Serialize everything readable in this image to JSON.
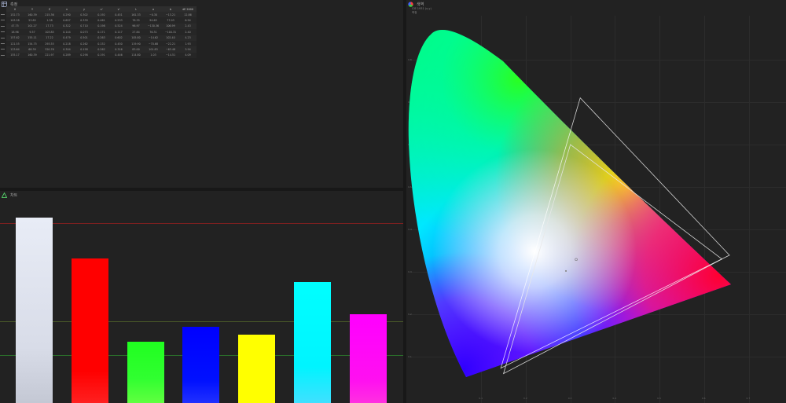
{
  "table_panel": {
    "title": "측정",
    "columns": [
      "X",
      "Y",
      "Z",
      "x",
      "y",
      "u'",
      "v'",
      "L",
      "a",
      "b",
      "dE 2000"
    ],
    "rows": [
      [
        "152.73",
        "160.39",
        "215.36",
        "0.290",
        "0.302",
        "0.192",
        "0.451",
        "161.33",
        "−0.30",
        "−13.21",
        "12.86"
      ],
      [
        "103.58",
        "53.85",
        "1.58",
        "0.657",
        "0.339",
        "0.461",
        "0.533",
        "78.35",
        "94.65",
        "77.03",
        "6.94"
      ],
      [
        "47.75",
        "101.27",
        "17.73",
        "0.322",
        "0.710",
        "0.198",
        "0.524",
        "96.97",
        "−130.36",
        "106.99",
        "2.43"
      ],
      [
        "18.96",
        "9.57",
        "103.85",
        "0.144",
        "0.073",
        "0.171",
        "0.117",
        "27.84",
        "76.31",
        "−104.31",
        "2.40"
      ],
      [
        "157.62",
        "155.11",
        "17.22",
        "0.479",
        "0.501",
        "0.263",
        "0.602",
        "105.80",
        "−14.62",
        "102.40",
        "4.23"
      ],
      [
        "121.55",
        "154.75",
        "293.55",
        "0.218",
        "0.262",
        "0.152",
        "0.450",
        "119.90",
        "−70.68",
        "−22.21",
        "1.93"
      ],
      [
        "123.64",
        "68.39",
        "320.76",
        "0.304",
        "0.158",
        "0.262",
        "0.316",
        "83.00",
        "101.83",
        "−63.48",
        "3.94"
      ],
      [
        "155.17",
        "160.39",
        "221.97",
        "0.289",
        "0.298",
        "0.191",
        "0.446",
        "114.80",
        "1.03",
        "−14.51",
        "4.09"
      ]
    ]
  },
  "chart_panel": {
    "title": "차트"
  },
  "chart_data": {
    "type": "bar",
    "categories": [
      "white",
      "red",
      "green",
      "blue",
      "yellow",
      "cyan",
      "magenta"
    ],
    "values": [
      100,
      78,
      33,
      41,
      37,
      65,
      48
    ],
    "colors": [
      "#e4e8f3",
      "#ff0000",
      "#2aff2a",
      "#0000ff",
      "#ffff00",
      "#00ffff",
      "#ff00ff"
    ],
    "ylim": [
      0,
      110
    ],
    "ref_lines": [
      {
        "value": 97,
        "color": "#7a2020"
      },
      {
        "value": 44,
        "color": "#4a5a28"
      },
      {
        "value": 26,
        "color": "#2a6e2a"
      }
    ]
  },
  "cie_panel": {
    "title": "색역",
    "info_line1": "CIE 1931 (x,y)",
    "info_line2": "측정",
    "x_ticks": [
      "0.1",
      "0.2",
      "0.3",
      "0.4",
      "0.5",
      "0.6",
      "0.7"
    ],
    "y_ticks": [
      "0.8",
      "0.7",
      "0.6",
      "0.5",
      "0.4",
      "0.3",
      "0.2",
      "0.1"
    ],
    "gamut_measured": [
      [
        0.657,
        0.339
      ],
      [
        0.322,
        0.71
      ],
      [
        0.144,
        0.073
      ]
    ],
    "gamut_target": [
      [
        0.64,
        0.33
      ],
      [
        0.3,
        0.6
      ],
      [
        0.15,
        0.06
      ]
    ],
    "white_point": [
      0.29,
      0.302
    ],
    "white_target": [
      0.313,
      0.329
    ]
  }
}
